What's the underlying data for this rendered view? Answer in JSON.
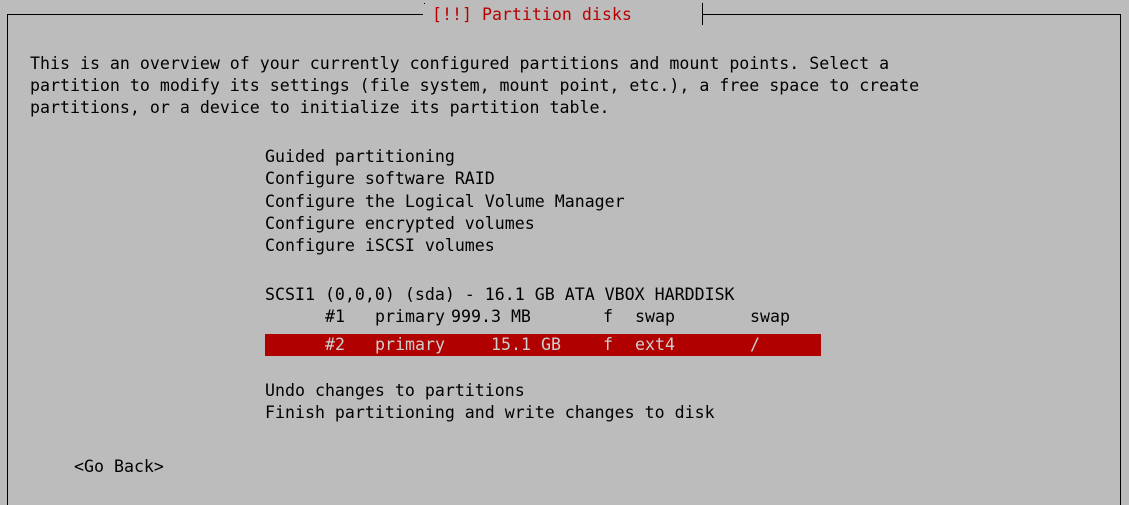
{
  "dialog": {
    "title": "[!!] Partition disks"
  },
  "description": [
    "This is an overview of your currently configured partitions and mount points. Select a",
    "partition to modify its settings (file system, mount point, etc.), a free space to create",
    "partitions, or a device to initialize its partition table."
  ],
  "menu": {
    "tools": [
      "Guided partitioning",
      "Configure software RAID",
      "Configure the Logical Volume Manager",
      "Configure encrypted volumes",
      "Configure iSCSI volumes"
    ],
    "disk": "SCSI1 (0,0,0) (sda) - 16.1 GB ATA VBOX HARDDISK",
    "partitions": [
      {
        "number": "#1",
        "type": "primary",
        "size": "999.3 MB",
        "flag": "f",
        "fs": "swap",
        "mount": "swap",
        "selected": false
      },
      {
        "number": "#2",
        "type": "primary",
        "size": "15.1 GB",
        "flag": "f",
        "fs": "ext4",
        "mount": "/",
        "selected": true
      }
    ],
    "actions": [
      "Undo changes to partitions",
      "Finish partitioning and write changes to disk"
    ]
  },
  "buttons": {
    "go_back": "<Go Back>"
  },
  "colors": {
    "background": "#bcbcbc",
    "title_text": "#b80000",
    "selection_bg": "#b00000",
    "selection_text": "#cfcfcf",
    "frame": "#000000"
  }
}
